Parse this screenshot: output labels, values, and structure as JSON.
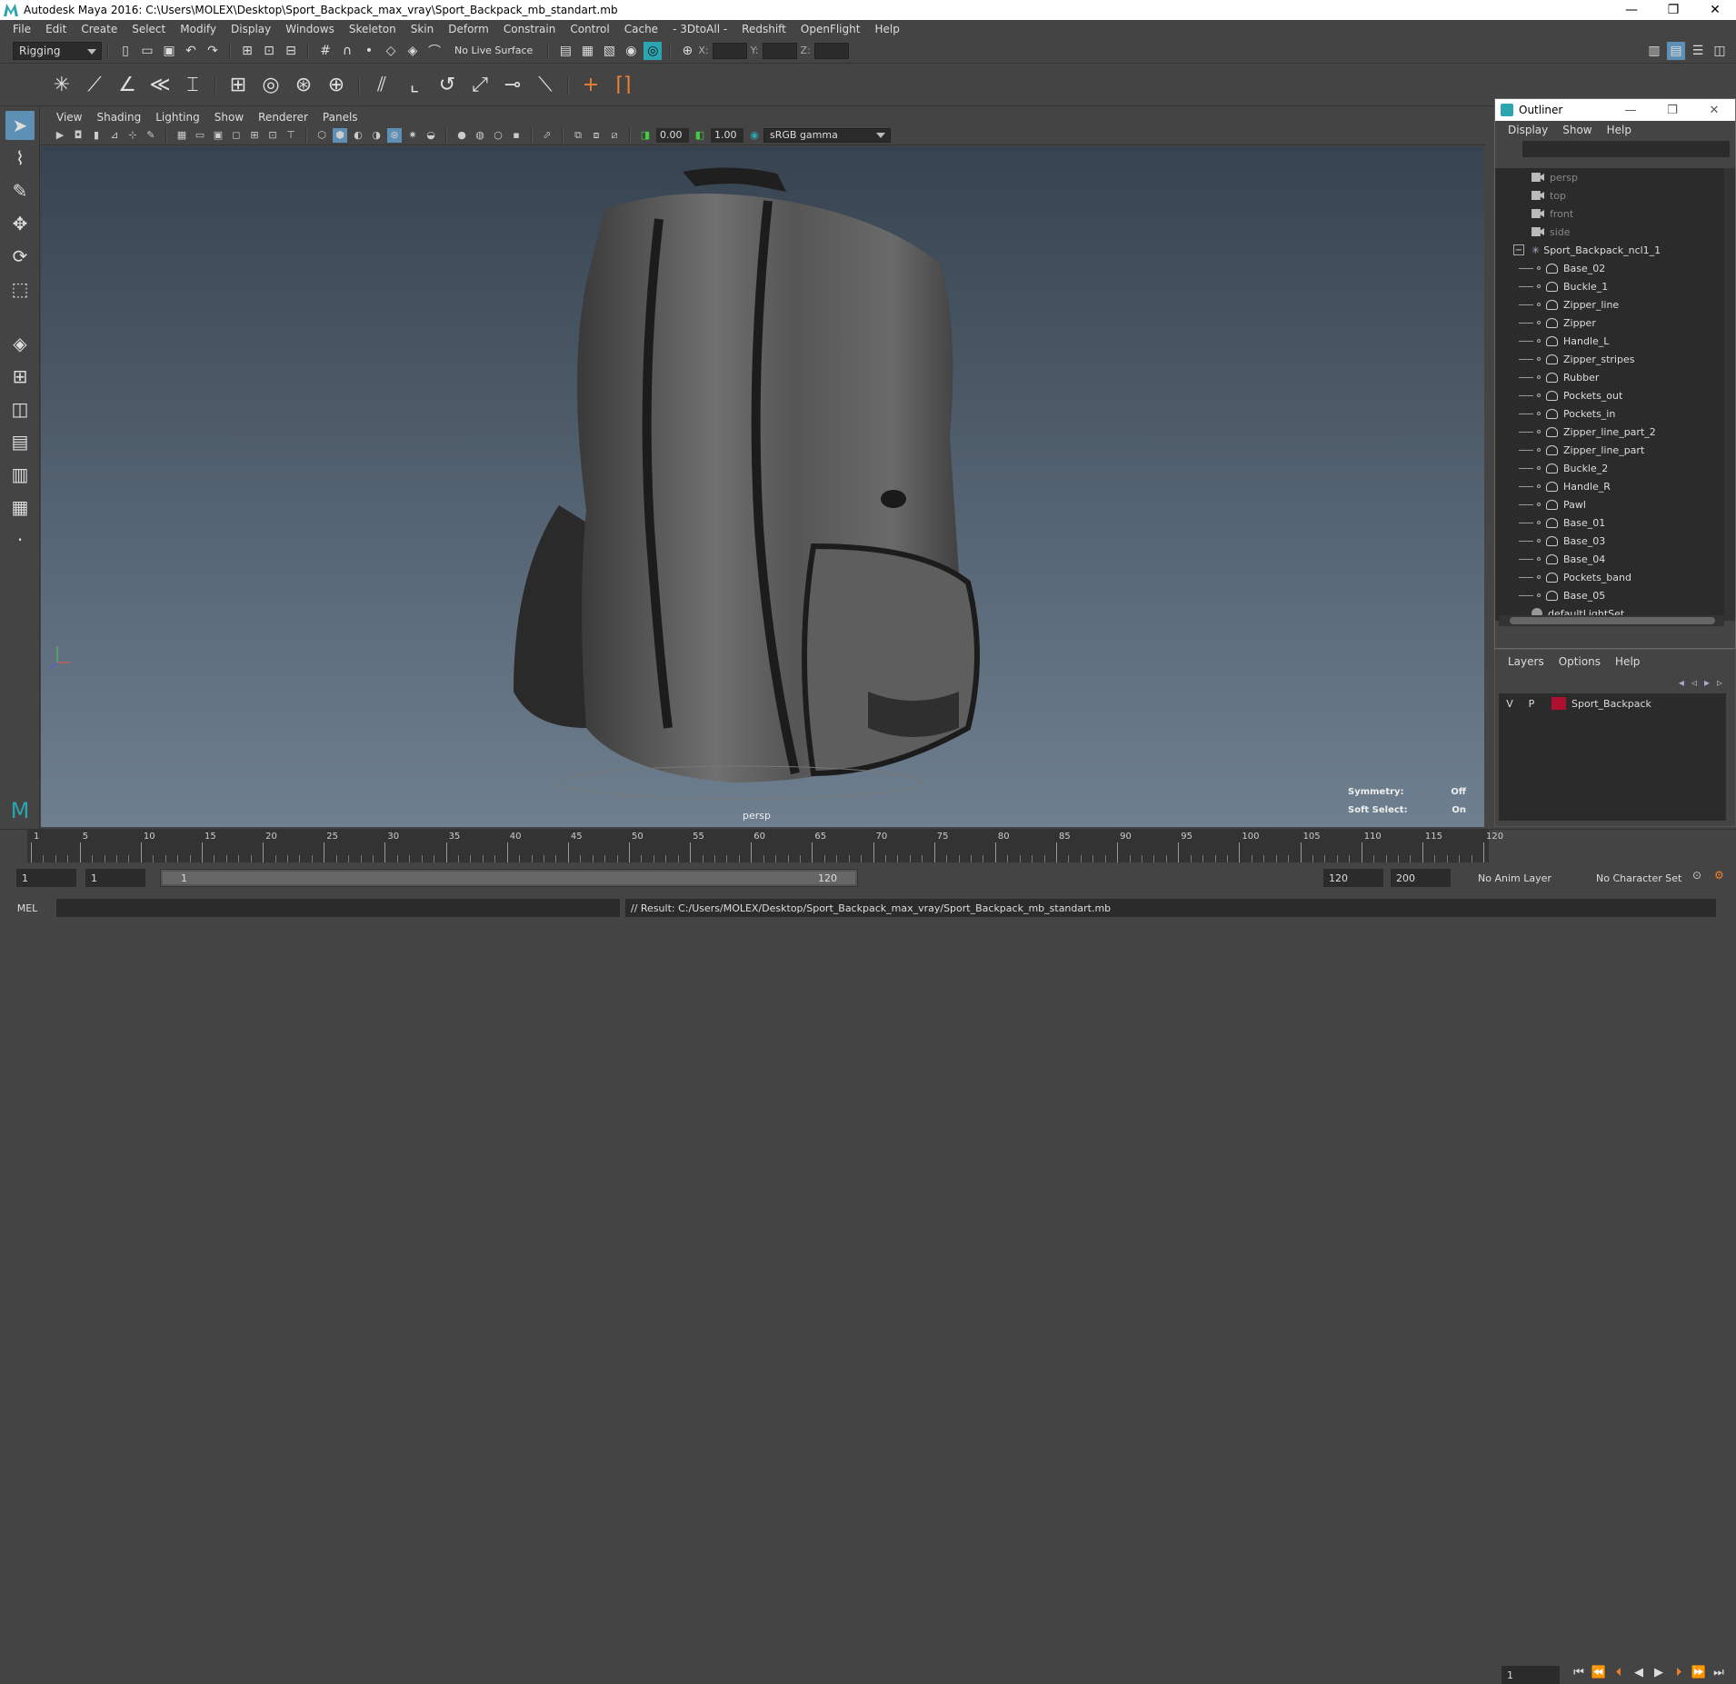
{
  "title": "Autodesk Maya 2016: C:\\Users\\MOLEX\\Desktop\\Sport_Backpack_max_vray\\Sport_Backpack_mb_standart.mb",
  "window_controls": [
    "—",
    "❐",
    "✕"
  ],
  "menu": [
    "File",
    "Edit",
    "Create",
    "Select",
    "Modify",
    "Display",
    "Windows",
    "Skeleton",
    "Skin",
    "Deform",
    "Constrain",
    "Control",
    "Cache",
    "- 3DtoAll -",
    "Redshift",
    "OpenFlight",
    "Help"
  ],
  "status": {
    "mode": "Rigging",
    "live_surface": "No Live Surface",
    "x_label": "X:",
    "y_label": "Y:",
    "z_label": "Z:"
  },
  "panel_menu": [
    "View",
    "Shading",
    "Lighting",
    "Show",
    "Renderer",
    "Panels"
  ],
  "panel_toolbar": {
    "value1": "0.00",
    "value2": "1.00",
    "color_space": "sRGB gamma"
  },
  "viewport": {
    "camera": "persp",
    "symmetry_label": "Symmetry:",
    "symmetry_value": "Off",
    "soft_select_label": "Soft Select:",
    "soft_select_value": "On"
  },
  "outliner": {
    "title": "Outliner",
    "menu": [
      "Display",
      "Show",
      "Help"
    ],
    "cameras": [
      "persp",
      "top",
      "front",
      "side"
    ],
    "group": "Sport_Backpack_ncl1_1",
    "children": [
      "Base_02",
      "Buckle_1",
      "Zipper_line",
      "Zipper",
      "Handle_L",
      "Zipper_stripes",
      "Rubber",
      "Pockets_out",
      "Pockets_in",
      "Zipper_line_part_2",
      "Zipper_line_part",
      "Buckle_2",
      "Handle_R",
      "Pawl",
      "Base_01",
      "Base_03",
      "Base_04",
      "Pockets_band",
      "Base_05"
    ],
    "light_set": "defaultLightSet"
  },
  "layers": {
    "menu": [
      "Layers",
      "Options",
      "Help"
    ],
    "row": {
      "v": "V",
      "p": "P",
      "name": "Sport_Backpack",
      "color": "#b01030"
    }
  },
  "timeline": {
    "ticks": [
      1,
      5,
      10,
      15,
      20,
      25,
      30,
      35,
      40,
      45,
      50,
      55,
      60,
      65,
      70,
      75,
      80,
      85,
      90,
      95,
      100,
      105,
      110,
      115,
      120
    ],
    "current_frame": "1"
  },
  "range": {
    "start": "1",
    "start2": "1",
    "slider_start": "1",
    "slider_end": "120",
    "end": "120",
    "end2": "200",
    "anim_layer": "No Anim Layer",
    "char_set": "No Character Set"
  },
  "cmd": {
    "lang": "MEL",
    "result": "// Result: C:/Users/MOLEX/Desktop/Sport_Backpack_max_vray/Sport_Backpack_mb_standart.mb"
  }
}
